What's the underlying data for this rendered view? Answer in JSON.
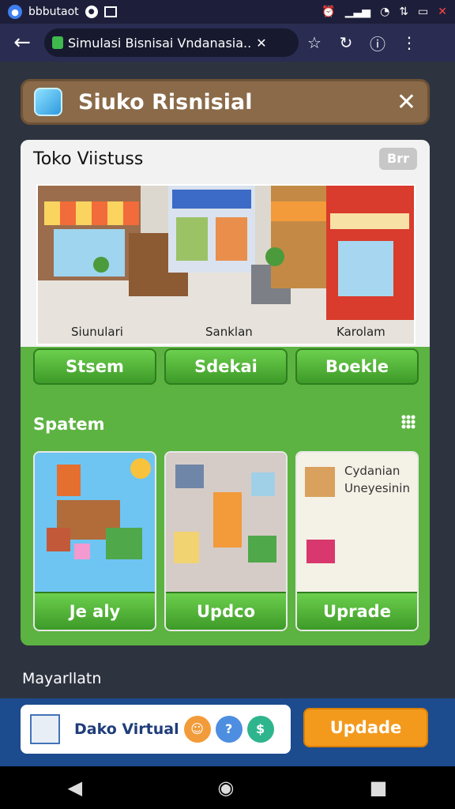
{
  "status": {
    "app_name": "bbbutaot"
  },
  "browser": {
    "tab_title": "Simulasi Bisnisai Vndanasia..",
    "close_label": "✕"
  },
  "header": {
    "title": "Siuko Risnisial"
  },
  "panel": {
    "title": "Toko Viistuss",
    "badge": "Brr",
    "scene_labels": [
      "Siunulari",
      "Sanklan",
      "Karolam"
    ],
    "buttons": [
      "Stsem",
      "Sdekai",
      "Boekle"
    ]
  },
  "section": {
    "title": "Spatem"
  },
  "cards": [
    {
      "button": "Je aly"
    },
    {
      "button": "Updco"
    },
    {
      "button": "Uprade",
      "text_line1": "Cydanian",
      "text_line2": "Uneyesinin"
    }
  ],
  "footer": {
    "label": "Mayarllatn"
  },
  "bottom_bar": {
    "item_title": "Dako Virtual",
    "icon3_label": "$",
    "update_label": "Updade"
  },
  "colors": {
    "accent_green": "#5cb341",
    "title_brown": "#8a6a48",
    "update_orange": "#f39a1c"
  }
}
